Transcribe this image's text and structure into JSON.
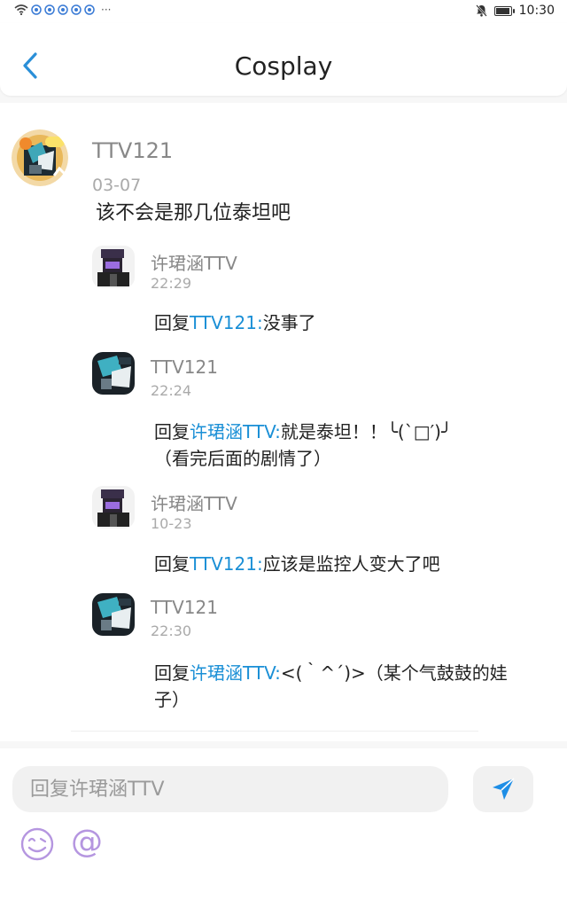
{
  "status_bar": {
    "time": "10:30",
    "dots": "···"
  },
  "header": {
    "title": "Cosplay"
  },
  "thread": {
    "main": {
      "username": "TTV121",
      "date": "03-07",
      "content": "该不会是那几位泰坦吧"
    },
    "replies": [
      {
        "username": "许珺涵TTV",
        "date": "22:29",
        "prefix": "回复",
        "mention": "TTV121:",
        "text": "没事了"
      },
      {
        "username": "TTV121",
        "date": "22:24",
        "prefix": "回复",
        "mention": "许珺涵TTV:",
        "text": "就是泰坦！！╰(`□′)╯",
        "text_line2": "（看完后面的剧情了）"
      },
      {
        "username": "许珺涵TTV",
        "date": "10-23",
        "prefix": "回复",
        "mention": "TTV121:",
        "text": "应该是监控人变大了吧"
      },
      {
        "username": "TTV121",
        "date": "22:30",
        "prefix": "回复",
        "mention": "许珺涵TTV:",
        "text": "<(｀^´)>（某个气鼓鼓的娃",
        "text_line2": "子）"
      }
    ]
  },
  "reply_bar": {
    "placeholder": "回复许珺涵TTV",
    "at_symbol": "@"
  },
  "colors": {
    "accent_blue": "#1a8fd6",
    "icon_purple": "#b596e0",
    "send_blue": "#1e8ee6"
  }
}
